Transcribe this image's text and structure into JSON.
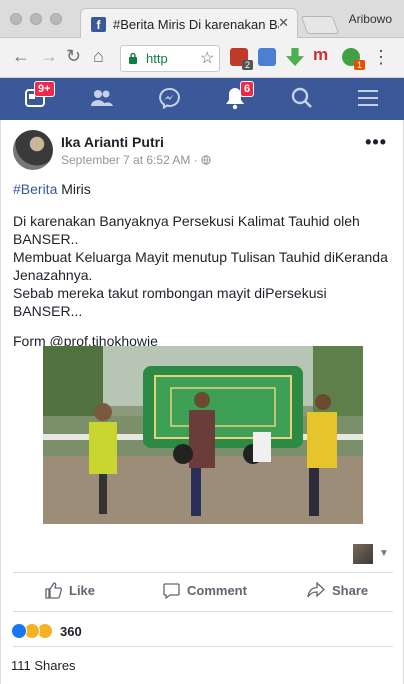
{
  "browser": {
    "tab_title": "#Berita Miris Di karenakan Ba",
    "tab_close": "✕",
    "profile_name": "Aribowo",
    "url_text": "http",
    "ext_badges": [
      "2",
      "1"
    ]
  },
  "fb_nav": {
    "home_badge": "9+",
    "notifications_badge": "6"
  },
  "post": {
    "author": "Ika Arianti Putri",
    "timestamp": "September 7 at 6:52 AM",
    "separator": "·",
    "more": "•••",
    "hashtag": "#Berita",
    "title_after_hashtag": " Miris",
    "paragraph": "Di karenakan Banyaknya Persekusi Kalimat Tauhid oleh BANSER..\nMembuat Keluarga Mayit menutup Tulisan Tauhid diKeranda Jenazahnya.\nSebab mereka takut rombongan mayit diPersekusi BANSER...",
    "credit": "Form @prof.tjhokhowie"
  },
  "actions": {
    "like": "Like",
    "comment": "Comment",
    "share": "Share"
  },
  "stats": {
    "reaction_count": "360",
    "shares": "111 Shares"
  },
  "colors": {
    "facebook_blue": "#3b5998",
    "link_blue": "#365899",
    "badge_red": "#f02849"
  }
}
